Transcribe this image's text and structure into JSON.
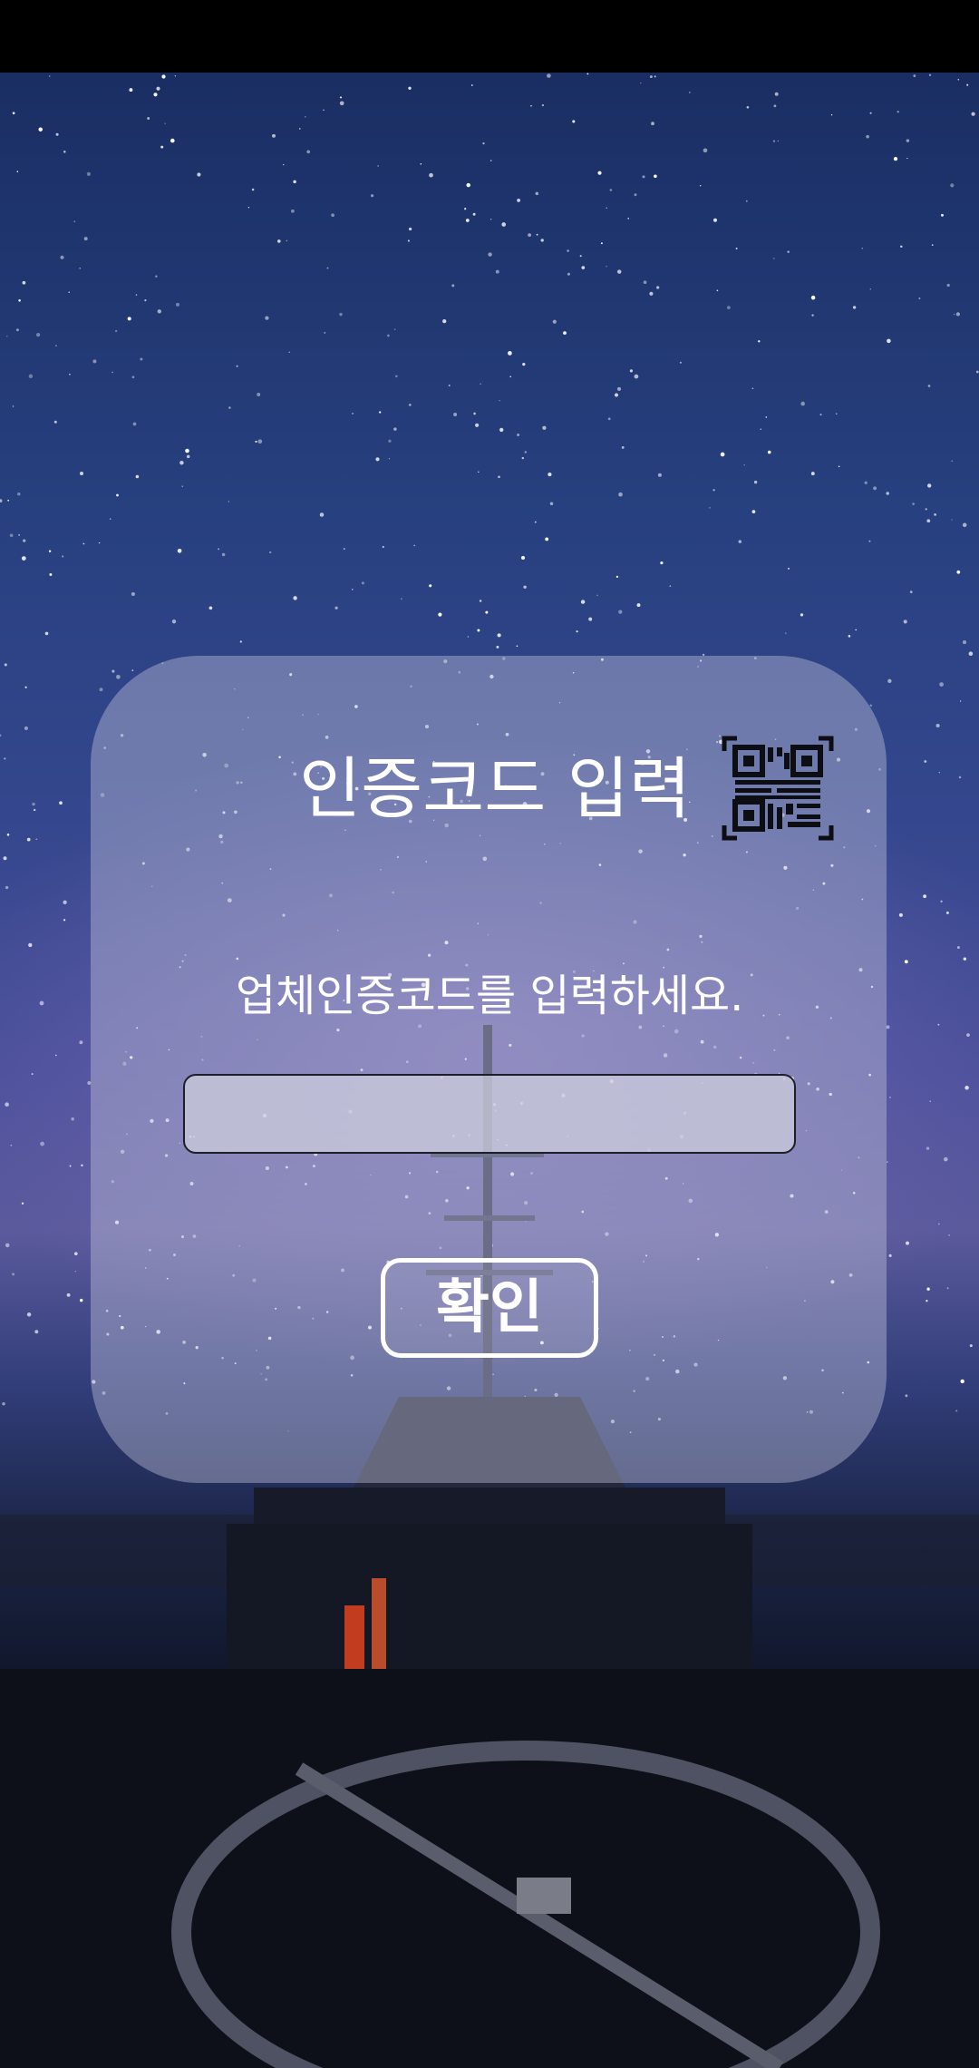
{
  "dialog": {
    "title": "인증코드 입력",
    "prompt": "업체인증코드를 입력하세요.",
    "input_value": "",
    "input_placeholder": "",
    "confirm_label": "확인",
    "qr_icon": "qr-code-icon"
  },
  "colors": {
    "text": "#ffffff",
    "card_background": "rgba(196,196,220,0.42)",
    "input_background": "rgba(206,206,222,0.75)"
  }
}
